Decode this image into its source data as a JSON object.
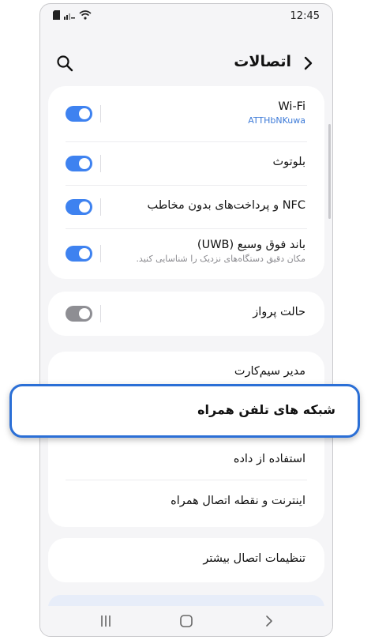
{
  "status_bar": {
    "time": "12:45",
    "icons": [
      "sim-icon",
      "signal-icon",
      "wifi-icon"
    ]
  },
  "header": {
    "title": "اتصالات",
    "back_icon": "chevron-right-icon",
    "search_icon": "search-icon"
  },
  "groups": [
    {
      "items": [
        {
          "title": "Wi-Fi",
          "subtitle": "ATTHbNKuwa",
          "subtitle_accent": true,
          "toggle": "on"
        },
        {
          "title": "بلوتوث",
          "toggle": "on"
        },
        {
          "title": "NFC و پرداخت‌های بدون مخاطب",
          "toggle": "on"
        },
        {
          "title": "باند فوق وسیع (UWB)",
          "subtitle": "مکان دقیق دستگاه‌های نزدیک را شناسایی کنید.",
          "toggle": "on"
        }
      ]
    },
    {
      "items": [
        {
          "title": "حالت پرواز",
          "toggle": "off"
        }
      ]
    },
    {
      "items": [
        {
          "title": "مدیر سیم‌کارت"
        },
        {
          "title": "شبکه های تلفن همراه",
          "highlighted": true
        },
        {
          "title": "استفاده از داده"
        },
        {
          "title": "اینترنت و نقطه اتصال همراه"
        }
      ]
    },
    {
      "items": [
        {
          "title": "تنظیمات اتصال بیشتر"
        }
      ]
    }
  ],
  "nav_bar": {
    "icons": [
      "recent-apps-icon",
      "home-icon",
      "back-icon"
    ]
  },
  "colors": {
    "accent": "#3e82f0",
    "highlight_border": "#2b6fd6",
    "toggle_off": "#8e8e93",
    "background": "#f5f5f7"
  }
}
